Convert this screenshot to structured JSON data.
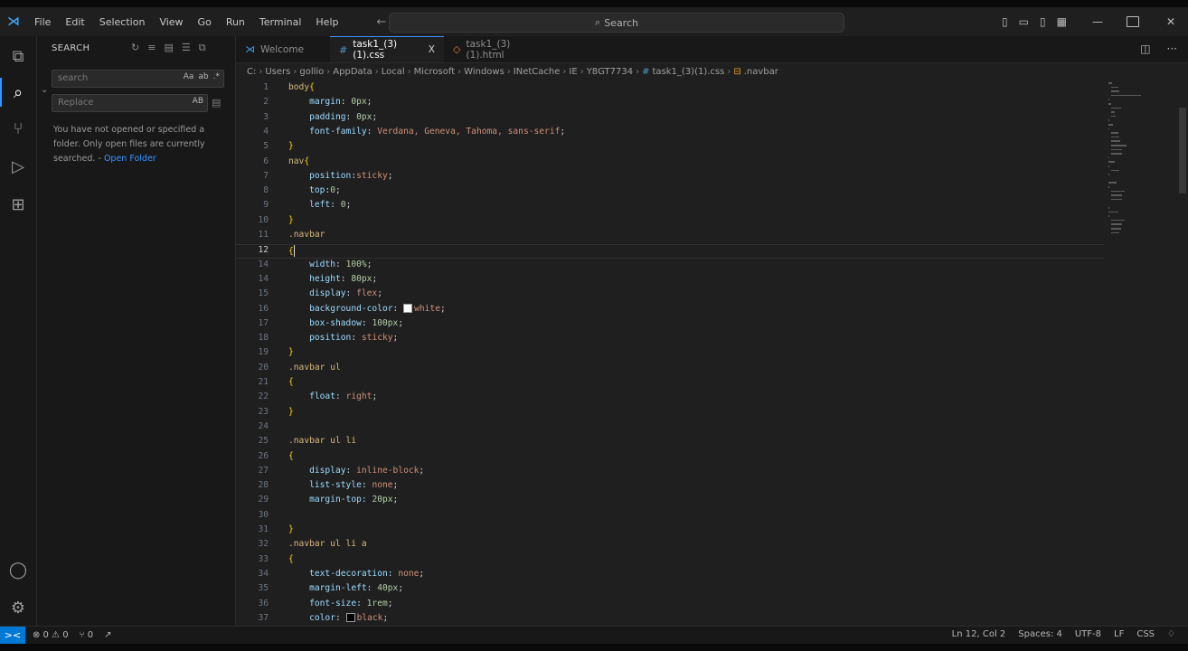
{
  "titlebar": {
    "menu": [
      "File",
      "Edit",
      "Selection",
      "View",
      "Go",
      "Run",
      "Terminal",
      "Help"
    ],
    "search_placeholder": "Search"
  },
  "sidebar": {
    "title": "SEARCH",
    "search_value": "search",
    "search_options": [
      "Aa",
      "ab",
      ".*"
    ],
    "replace_placeholder": "Replace",
    "replace_option": "AB",
    "message": "You have not opened or specified a folder. Only open files are currently searched. -",
    "open_folder_link": "Open Folder"
  },
  "tabs": [
    {
      "label": "Welcome",
      "icon": "vscode-logo-icon"
    },
    {
      "label": "task1_(3)(1).css",
      "icon": "#",
      "close": "X"
    },
    {
      "label": "task1_(3)(1).html",
      "icon": "html-icon"
    }
  ],
  "breadcrumb": [
    "C:",
    "Users",
    "gollio",
    "AppData",
    "Local",
    "Microsoft",
    "Windows",
    "INetCache",
    "IE",
    "Y8GT7734",
    "task1_(3)(1).css",
    ".navbar"
  ],
  "editor": {
    "lines": [
      {
        "n": "1",
        "code": "body{"
      },
      {
        "n": "2",
        "code": "    margin: 0px;"
      },
      {
        "n": "3",
        "code": "    padding: 0px;"
      },
      {
        "n": "4",
        "code": "    font-family: Verdana, Geneva, Tahoma, sans-serif;"
      },
      {
        "n": "5",
        "code": "}"
      },
      {
        "n": "6",
        "code": "nav{"
      },
      {
        "n": "7",
        "code": "    position:sticky;"
      },
      {
        "n": "8",
        "code": "    top:0;"
      },
      {
        "n": "9",
        "code": "    left: 0;"
      },
      {
        "n": "10",
        "code": "}"
      },
      {
        "n": "11",
        "code": ".navbar"
      },
      {
        "n": "12",
        "code": "{"
      },
      {
        "n": "14",
        "code": "    width: 100%;"
      },
      {
        "n": "14",
        "code": "    height: 80px;"
      },
      {
        "n": "15",
        "code": "    display: flex;"
      },
      {
        "n": "16",
        "code": "    background-color: white;"
      },
      {
        "n": "17",
        "code": "    box-shadow: 100px;"
      },
      {
        "n": "18",
        "code": "    position: sticky;"
      },
      {
        "n": "19",
        "code": "}"
      },
      {
        "n": "20",
        "code": ".navbar ul"
      },
      {
        "n": "21",
        "code": "{"
      },
      {
        "n": "22",
        "code": "    float: right;"
      },
      {
        "n": "23",
        "code": "}"
      },
      {
        "n": "24",
        "code": ""
      },
      {
        "n": "25",
        "code": ".navbar ul li"
      },
      {
        "n": "26",
        "code": "{"
      },
      {
        "n": "27",
        "code": "    display: inline-block;"
      },
      {
        "n": "28",
        "code": "    list-style: none;"
      },
      {
        "n": "29",
        "code": "    margin-top: 20px;"
      },
      {
        "n": "30",
        "code": ""
      },
      {
        "n": "31",
        "code": "}"
      },
      {
        "n": "32",
        "code": ".navbar ul li a"
      },
      {
        "n": "33",
        "code": "{"
      },
      {
        "n": "34",
        "code": "    text-decoration: none;"
      },
      {
        "n": "35",
        "code": "    margin-left: 40px;"
      },
      {
        "n": "36",
        "code": "    font-size: 1rem;"
      },
      {
        "n": "37",
        "code": "    color: black;"
      }
    ],
    "current_line_index": 11
  },
  "statusbar": {
    "remote": "><",
    "problems": "⊗ 0 ⚠ 0",
    "ports": "⑂ 0",
    "cursor": "Ln 12, Col 2",
    "spaces": "Spaces: 4",
    "encoding": "UTF-8",
    "eol": "LF",
    "language": "CSS"
  },
  "colors": {
    "accent": "#3794ff",
    "remote_bg": "#0078d4",
    "editor_bg": "#1f1f1f",
    "sidebar_bg": "#181818",
    "selector": "#d7ba7d",
    "property": "#9cdcfe",
    "value": "#ce9178"
  }
}
